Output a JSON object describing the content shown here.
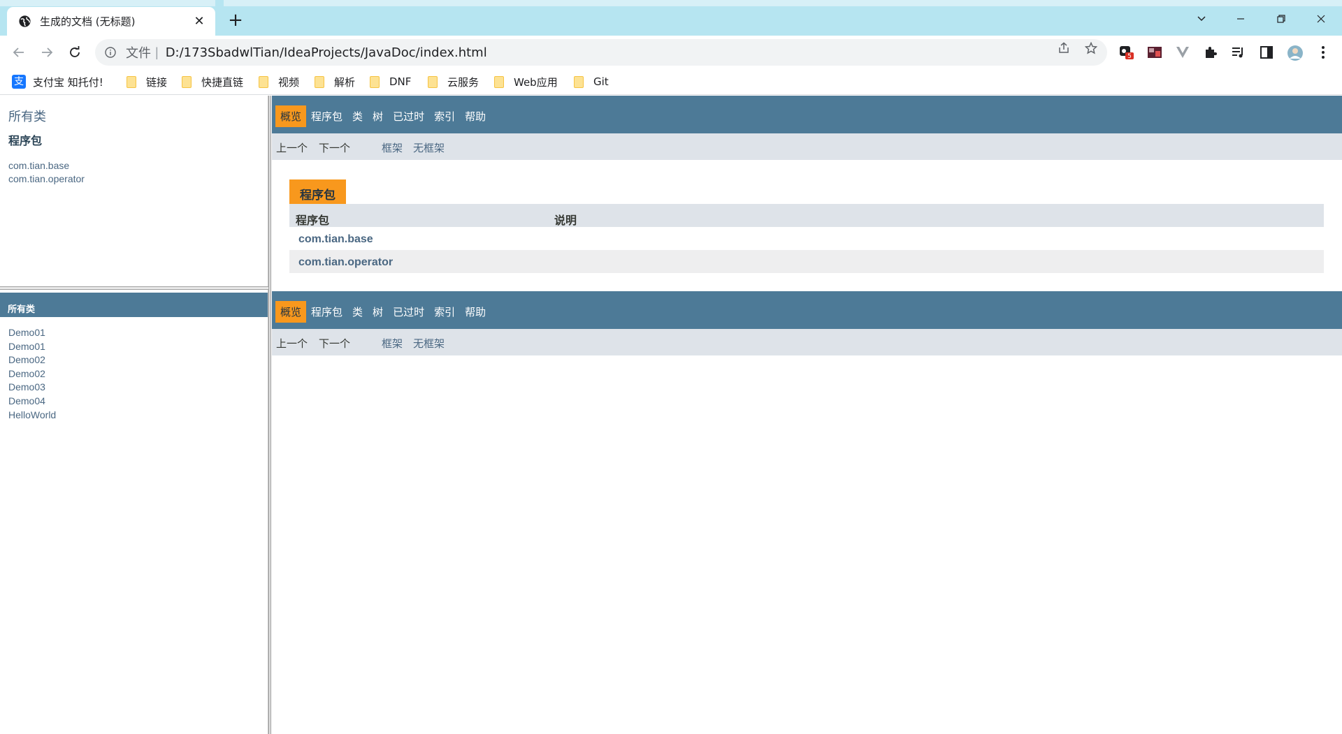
{
  "browser": {
    "tab_title": "生成的文档 (无标题)",
    "tab_close": "✕",
    "new_tab": "+",
    "url_scheme": "文件",
    "url_separator": "|",
    "url": "D:/173SbadwlTian/IdeaProjects/JavaDoc/index.html",
    "extension_badge": "5",
    "bookmarks": [
      {
        "label": "支付宝 知托付!",
        "icon": "alipay-icon"
      },
      {
        "label": "链接",
        "icon": "folder-icon"
      },
      {
        "label": "快捷直链",
        "icon": "folder-icon"
      },
      {
        "label": "视频",
        "icon": "folder-icon"
      },
      {
        "label": "解析",
        "icon": "folder-icon"
      },
      {
        "label": "DNF",
        "icon": "folder-icon"
      },
      {
        "label": "云服务",
        "icon": "folder-icon"
      },
      {
        "label": "Web应用",
        "icon": "folder-icon"
      },
      {
        "label": "Git",
        "icon": "folder-icon"
      }
    ]
  },
  "left_top": {
    "title": "所有类",
    "subtitle": "程序包",
    "packages": [
      "com.tian.base",
      "com.tian.operator"
    ]
  },
  "left_bottom": {
    "header": "所有类",
    "classes": [
      "Demo01",
      "Demo01",
      "Demo02",
      "Demo02",
      "Demo03",
      "Demo04",
      "HelloWorld"
    ]
  },
  "nav": {
    "items": [
      "概览",
      "程序包",
      "类",
      "树",
      "已过时",
      "索引",
      "帮助"
    ],
    "active_index": 0,
    "prev": "上一个",
    "next": "下一个",
    "frames": "框架",
    "no_frames": "无框架"
  },
  "overview": {
    "caption": "程序包",
    "col_package": "程序包",
    "col_description": "说明",
    "rows": [
      {
        "package": "com.tian.base",
        "description": ""
      },
      {
        "package": "com.tian.operator",
        "description": ""
      }
    ]
  },
  "colors": {
    "nav_bg": "#4d7a97",
    "active_tab": "#f8981d",
    "subnav_bg": "#dee3e9",
    "link": "#4a6782",
    "tab_strip": "#b6e5f1"
  }
}
